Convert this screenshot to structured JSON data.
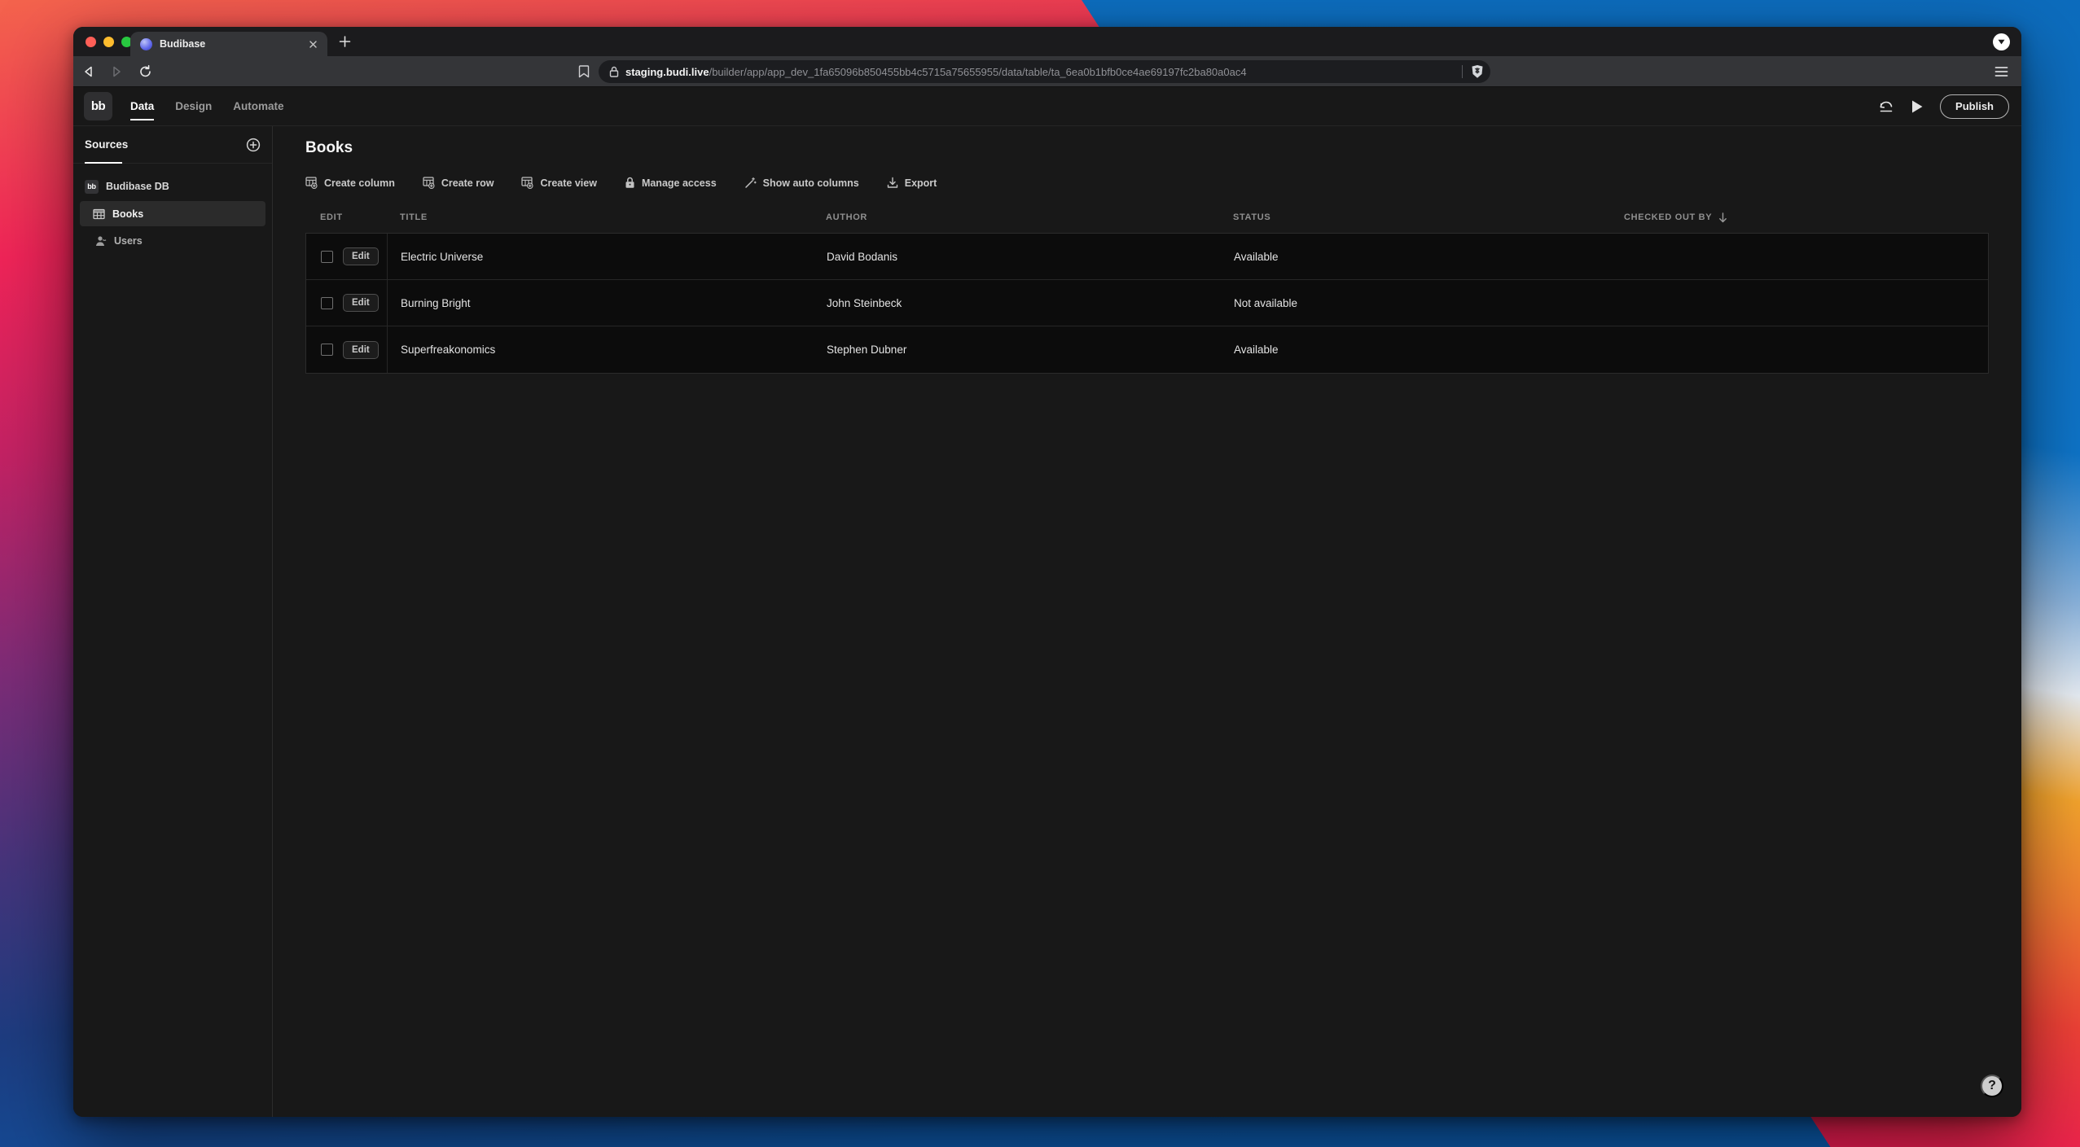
{
  "browser": {
    "tab_title": "Budibase",
    "url_domain": "staging.budi.live",
    "url_path": "/builder/app/app_dev_1fa65096b850455bb4c5715a75655955/data/table/ta_6ea0b1bfb0ce4ae69197fc2ba80a0ac4"
  },
  "app": {
    "logo_text": "bb",
    "nav": [
      {
        "label": "Data",
        "active": true
      },
      {
        "label": "Design",
        "active": false
      },
      {
        "label": "Automate",
        "active": false
      }
    ],
    "publish_label": "Publish",
    "sidebar": {
      "title": "Sources",
      "items": [
        {
          "label": "Budibase DB",
          "icon": "budibase-logo"
        },
        {
          "label": "Books",
          "icon": "table-icon",
          "selected": true
        },
        {
          "label": "Users",
          "icon": "user-icon"
        }
      ]
    },
    "content": {
      "title": "Books",
      "toolbar": [
        {
          "label": "Create column",
          "icon": "table-plus-icon"
        },
        {
          "label": "Create row",
          "icon": "table-plus-icon"
        },
        {
          "label": "Create view",
          "icon": "table-plus-icon"
        },
        {
          "label": "Manage access",
          "icon": "lock-icon"
        },
        {
          "label": "Show auto columns",
          "icon": "wand-icon"
        },
        {
          "label": "Export",
          "icon": "download-icon"
        }
      ],
      "table": {
        "columns": [
          "EDIT",
          "TITLE",
          "AUTHOR",
          "STATUS",
          "CHECKED OUT BY"
        ],
        "sorted_column": "CHECKED OUT BY",
        "sort_direction": "descending",
        "edit_label": "Edit",
        "rows": [
          {
            "title": "Electric Universe",
            "author": "David Bodanis",
            "status": "Available",
            "checked_out_by": ""
          },
          {
            "title": "Burning Bright",
            "author": "John Steinbeck",
            "status": "Not available",
            "checked_out_by": ""
          },
          {
            "title": "Superfreakonomics",
            "author": "Stephen Dubner",
            "status": "Available",
            "checked_out_by": ""
          }
        ]
      }
    },
    "help_label": "?"
  },
  "colors": {
    "traffic_close": "#ff5f57",
    "traffic_minimize": "#febc2e",
    "traffic_zoom": "#28c840",
    "favicon_purple": "#5b63e8",
    "app_background": "#181818",
    "table_background": "#0c0c0c"
  }
}
